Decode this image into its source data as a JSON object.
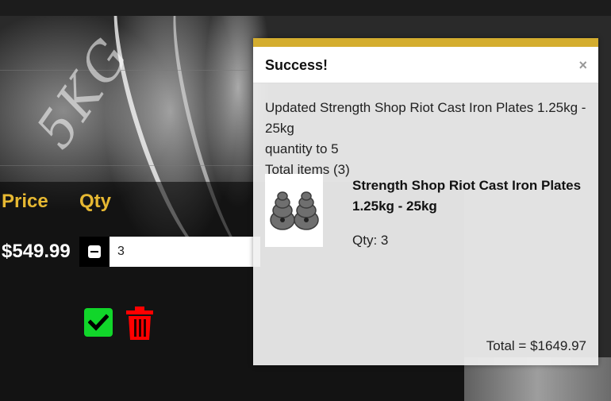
{
  "modal": {
    "title": "Success!",
    "close_label": "×",
    "message_line1": "Updated Strength Shop Riot Cast Iron Plates 1.25kg - 25kg",
    "message_line2": "quantity to 5",
    "total_items": "Total items (3)",
    "product_name": "Strength Shop Riot Cast Iron Plates 1.25kg - 25kg",
    "product_qty": "Qty: 3",
    "total": "Total = $1649.97"
  },
  "cart": {
    "price_header": "Price",
    "qty_header": "Qty",
    "price_value": "$549.99",
    "qty_value": "3"
  },
  "background": {
    "engraving": "5KG"
  },
  "colors": {
    "accent": "#d4ad2f",
    "header_text": "#e6b832",
    "confirm": "#11d62a",
    "delete": "#ff0000"
  },
  "icons": {
    "confirm": "check-icon",
    "delete": "trash-icon",
    "decrement": "minus-icon"
  }
}
